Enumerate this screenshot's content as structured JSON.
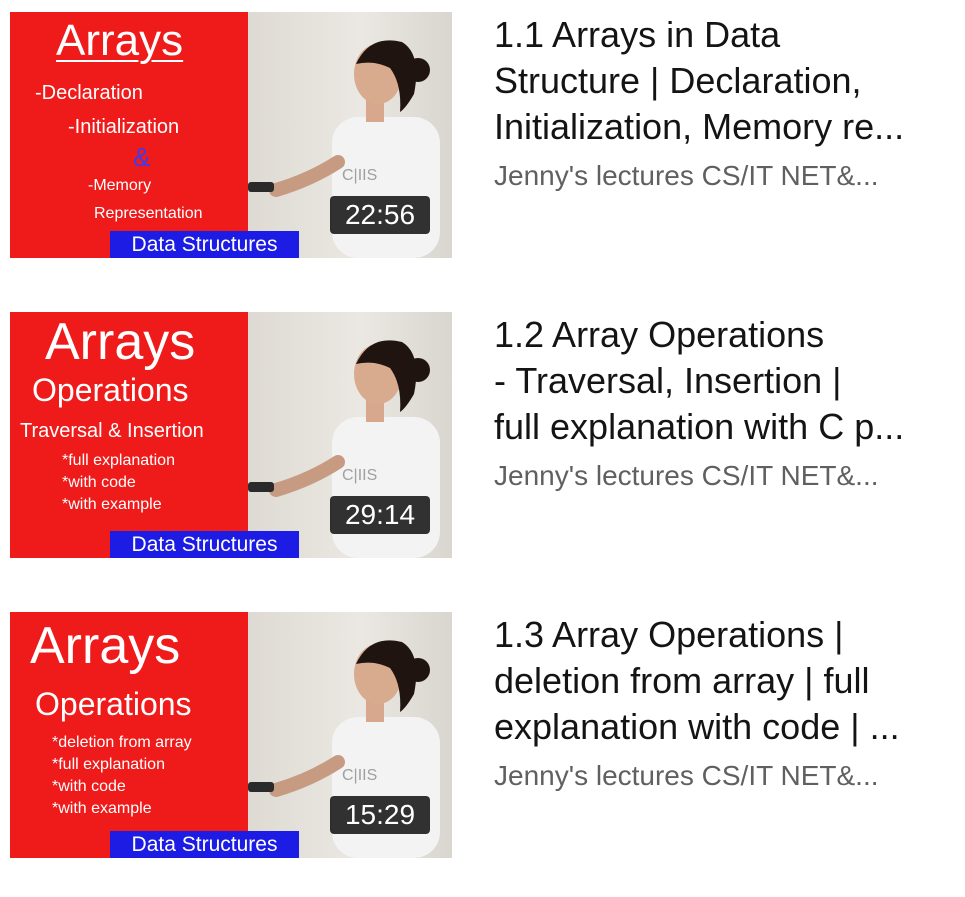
{
  "videos": [
    {
      "title_lines": [
        "1.1 Arrays in Data",
        "Structure | Declaration,",
        "Initialization, Memory re..."
      ],
      "channel": "Jenny's lectures CS/IT NET&...",
      "duration": "22:56",
      "thumbnail": {
        "heading": "Arrays",
        "lines": [
          "-Declaration",
          "-Initialization",
          "&",
          "-Memory",
          "Representation"
        ],
        "badge": "Data Structures"
      }
    },
    {
      "title_lines": [
        "1.2 Array Operations",
        "- Traversal, Insertion |",
        "full explanation with C p..."
      ],
      "channel": "Jenny's lectures CS/IT NET&...",
      "duration": "29:14",
      "thumbnail": {
        "heading": "Arrays",
        "subheading": "Operations",
        "lines": [
          "Traversal & Insertion",
          "*full explanation",
          "*with code",
          "*with example"
        ],
        "badge": "Data Structures"
      }
    },
    {
      "title_lines": [
        "1.3 Array Operations |",
        "deletion from array | full",
        "explanation with code | ..."
      ],
      "channel": "Jenny's lectures CS/IT NET&...",
      "duration": "15:29",
      "thumbnail": {
        "heading": "Arrays",
        "subheading": "Operations",
        "lines": [
          "*deletion from array",
          "*full explanation",
          "*with code",
          "*with example"
        ],
        "badge": "Data Structures"
      }
    }
  ],
  "colors": {
    "thumbnail_red": "#ef1a1a",
    "badge_blue": "#1c1ce4",
    "ampersand_blue": "#3c3cf0",
    "title_text": "#141414",
    "channel_text": "#606060"
  }
}
